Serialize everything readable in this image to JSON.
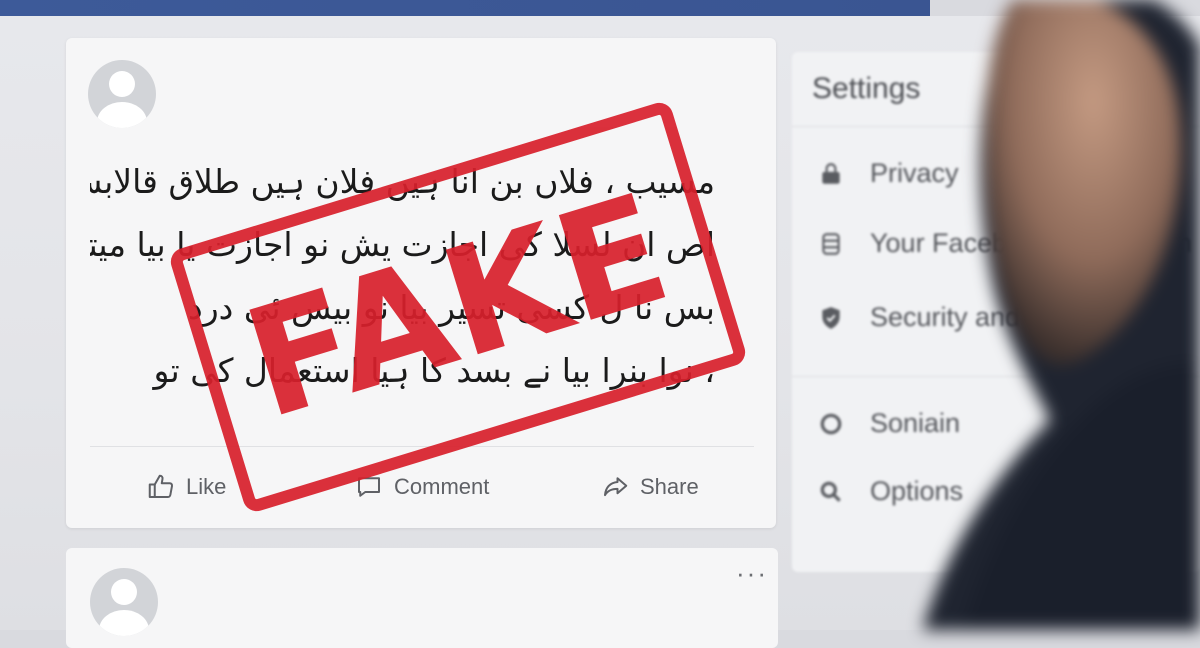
{
  "post": {
    "text_lines": [
      "مسیب ، فلاں بن انا ہیں فلان ہیں طلاق قالابس ن",
      "اص ان لسلا کی اجازت یش نو اجازت یا بیا میتا یہ",
      "بس نا ل کسی تسیر بیا نو بیس ئی درد",
      "، نوا بنرا بیا نے بسد کا ہیا استعمال کی تو"
    ],
    "stamp_text": "FAKE",
    "actions": {
      "like": "Like",
      "comment": "Comment",
      "share": "Share"
    },
    "more_label": "···"
  },
  "sidebar": {
    "title": "Settings",
    "items": [
      {
        "label": "Privacy",
        "icon": "lock-icon"
      },
      {
        "label": "Your Facebook information",
        "icon": "database-icon"
      },
      {
        "label": "Security and login",
        "icon": "shield-icon"
      },
      {
        "label": "Soniain",
        "icon": "circle-icon"
      },
      {
        "label": "Options",
        "icon": "search-icon"
      }
    ]
  },
  "colors": {
    "topbar": "#3d5a99",
    "stamp": "#d8202c",
    "card": "#f6f6f7"
  }
}
